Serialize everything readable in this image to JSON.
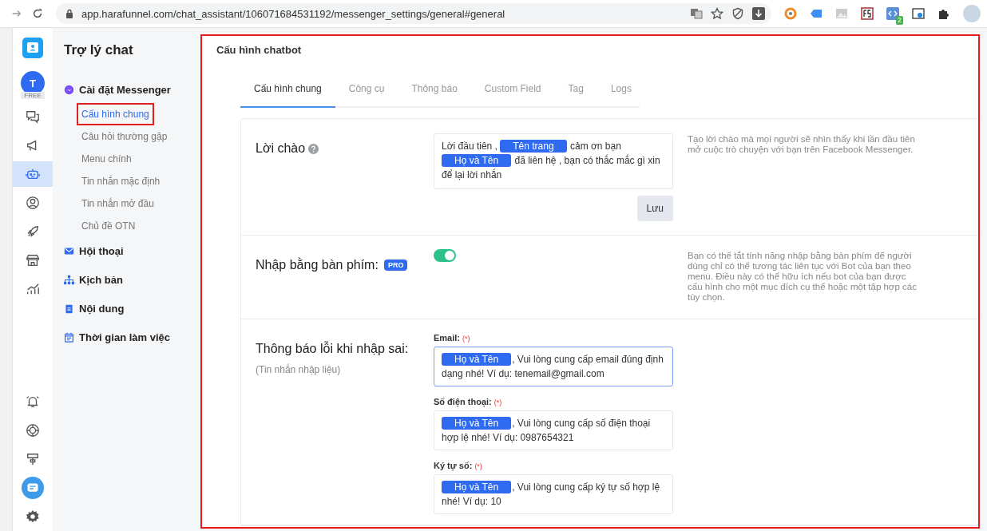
{
  "browser": {
    "url": "app.harafunnel.com/chat_assistant/106071684531192/messenger_settings/general#general",
    "extension_badge": "2"
  },
  "rail": [
    {
      "kind": "chat",
      "selected": false
    },
    {
      "kind": "megaphone",
      "selected": false
    },
    {
      "kind": "robot",
      "selected": true
    },
    {
      "kind": "user",
      "selected": false
    },
    {
      "kind": "rocket",
      "selected": false
    },
    {
      "kind": "store",
      "selected": false
    },
    {
      "kind": "chart",
      "selected": false
    }
  ],
  "rail_bottom": [
    {
      "kind": "bell"
    },
    {
      "kind": "globe"
    },
    {
      "kind": "signpost"
    },
    {
      "kind": "bubble"
    },
    {
      "kind": "gear"
    }
  ],
  "account": {
    "initial": "T",
    "plan": "FREE"
  },
  "sidebar": {
    "title": "Trợ lý chat",
    "groups": [
      {
        "label": "Cài đặt Messenger",
        "children": [
          {
            "label": "Cấu hình chung",
            "selected": true
          },
          {
            "label": "Câu hỏi thường gặp",
            "selected": false
          },
          {
            "label": "Menu chính",
            "selected": false
          },
          {
            "label": "Tin nhắn mặc định",
            "selected": false
          },
          {
            "label": "Tin nhắn mở đầu",
            "selected": false
          },
          {
            "label": "Chủ đề OTN",
            "selected": false
          }
        ]
      },
      {
        "label": "Hội thoại"
      },
      {
        "label": "Kịch bản"
      },
      {
        "label": "Nội dung"
      },
      {
        "label": "Thời gian làm việc"
      }
    ]
  },
  "page": {
    "title": "Cấu hình chatbot",
    "tabs": [
      {
        "label": "Cấu hình chung",
        "selected": true
      },
      {
        "label": "Công cụ",
        "selected": false
      },
      {
        "label": "Thông báo",
        "selected": false
      },
      {
        "label": "Custom Field",
        "selected": false
      },
      {
        "label": "Tag",
        "selected": false
      },
      {
        "label": "Logs",
        "selected": false
      }
    ],
    "greeting": {
      "label": "Lời chào",
      "message": [
        {
          "kind": "text",
          "text": "Lời đầu tiên ,"
        },
        {
          "kind": "tag",
          "text": "Tên trang"
        },
        {
          "kind": "text",
          "text": "cảm ơn bạn"
        },
        {
          "kind": "tag",
          "text": "Họ và Tên"
        },
        {
          "kind": "text",
          "text": "đã liên hệ , bạn có thắc mắc gì xin để lại lời nhắn"
        }
      ],
      "save": "Lưu",
      "description": "Tạo lời chào mà mọi người sẽ nhìn thấy khi lần đầu tiên mở cuộc trò chuyện với bạn trên Facebook Messenger."
    },
    "keyboard": {
      "label": "Nhập bằng bàn phím:",
      "badge": "PRO",
      "on": true,
      "description": "Bạn có thể tắt tính năng nhập bằng bàn phím để người dùng chỉ có thể tương tác liên tục với Bot của bạn theo menu. Điều này có thể hữu ích nếu bot của bạn được cấu hình cho một mục đích cụ thể hoặc một tập hợp các tùy chọn."
    },
    "errors": {
      "label": "Thông báo lỗi khi nhập sai:",
      "note": "(Tin nhắn nhập liệu)",
      "fields": [
        {
          "label": "Email:",
          "required": "(*)",
          "focused": true,
          "message": [
            {
              "kind": "tag",
              "text": "Họ và Tên"
            },
            {
              "kind": "text",
              "text": ", Vui lòng cung cấp email đúng định dạng nhé! Ví dụ: tenemail@gmail.com"
            }
          ]
        },
        {
          "label": "Số điện thoại:",
          "required": "(*)",
          "focused": false,
          "message": [
            {
              "kind": "tag",
              "text": "Họ và Tên"
            },
            {
              "kind": "text",
              "text": ", Vui lòng cung cấp số điện thoại hợp lệ nhé! Ví dụ: 0987654321"
            }
          ]
        },
        {
          "label": "Ký tự số:",
          "required": "(*)",
          "focused": false,
          "message": [
            {
              "kind": "tag",
              "text": "Họ và Tên"
            },
            {
              "kind": "text",
              "text": ", Vui lòng cung cấp ký tự số hợp lệ nhé! Ví dụ: 10"
            }
          ]
        }
      ]
    }
  }
}
